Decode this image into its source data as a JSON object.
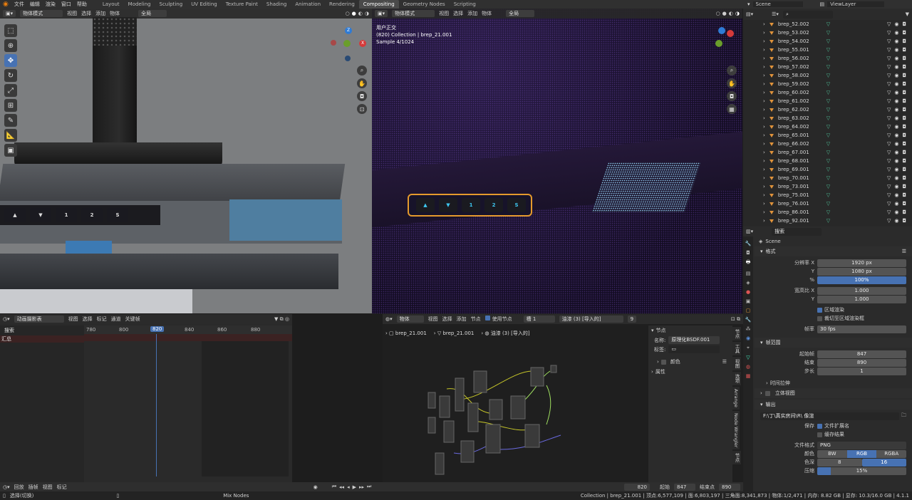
{
  "menu": [
    "文件",
    "编辑",
    "渲染",
    "窗口",
    "帮助"
  ],
  "workspaces": [
    "Layout",
    "Modeling",
    "Sculpting",
    "UV Editing",
    "Texture Paint",
    "Shading",
    "Animation",
    "Rendering",
    "Compositing",
    "Geometry Nodes",
    "Scripting"
  ],
  "scene": "Scene",
  "view_layer": "ViewLayer",
  "viewport_left": {
    "mode": "物体模式",
    "menus": [
      "视图",
      "选择",
      "添加",
      "物体"
    ],
    "transform": "全局",
    "keys": [
      "1",
      "2",
      "S"
    ]
  },
  "viewport_right": {
    "mode": "物体模式",
    "menus": [
      "视图",
      "选择",
      "添加",
      "物体"
    ],
    "transform": "全局",
    "overlay_line1": "用户正交",
    "overlay_line2": "(820) Collection | brep_21.001",
    "overlay_line3": "Sample 4/1024",
    "keys": [
      "1",
      "2",
      "S"
    ]
  },
  "outliner": {
    "search_placeholder": "",
    "items": [
      "brep_52.002",
      "brep_53.002",
      "brep_54.002",
      "brep_55.001",
      "brep_56.002",
      "brep_57.002",
      "brep_58.002",
      "brep_59.002",
      "brep_60.002",
      "brep_61.002",
      "brep_62.002",
      "brep_63.002",
      "brep_64.002",
      "brep_65.001",
      "brep_66.002",
      "brep_67.001",
      "brep_68.001",
      "brep_69.001",
      "brep_70.001",
      "brep_73.001",
      "brep_75.001",
      "brep_76.001",
      "brep_86.001",
      "brep_92.001"
    ]
  },
  "properties": {
    "search_placeholder": "搜索",
    "scene_name": "Scene",
    "format_title": "格式",
    "res_x_label": "分辨率 X",
    "res_x": "1920 px",
    "res_y_label": "Y",
    "res_y": "1080 px",
    "pct_label": "%",
    "pct": "100%",
    "aspect_x_label": "宽高比 X",
    "aspect_x": "1.000",
    "aspect_y_label": "Y",
    "aspect_y": "1.000",
    "border_label": "区域渲染",
    "crop_label": "裁切至区域渲染框",
    "fps_label": "帧率",
    "fps": "30 fps",
    "frame_range_title": "帧范围",
    "start_label": "起始帧",
    "start": "847",
    "end_label": "结束",
    "end": "890",
    "step_label": "步长",
    "step": "1",
    "time_stretch": "时间拉伸",
    "stereo": "立体视图",
    "output_title": "输出",
    "output_path": "F:\\丁\\真实房间\\R\\ 像渲",
    "save_label": "保存",
    "file_ext_label": "文件扩展名",
    "cache_label": "缓存结果",
    "file_format_label": "文件格式",
    "file_format": "PNG",
    "color_label": "颜色",
    "color_opts": [
      "BW",
      "RGB",
      "RGBA"
    ],
    "depth_label": "色深",
    "depth_opts": [
      "8",
      "16"
    ],
    "compression_label": "压缩",
    "compression": "15%"
  },
  "dopesheet": {
    "editor": "动画摄影表",
    "menus": [
      "视图",
      "选择",
      "标记",
      "通道",
      "关键帧"
    ],
    "search_placeholder": "搜索",
    "ticks": [
      "780",
      "800",
      "820",
      "840",
      "860",
      "880"
    ],
    "current": "820",
    "summary": "汇总"
  },
  "timeline": {
    "menus": [
      "回放",
      "插帧",
      "视图",
      "标记"
    ],
    "frame": "820",
    "start_label": "起始",
    "start": "847",
    "end_label": "结束点",
    "end": "890"
  },
  "node_editor": {
    "type": "物体",
    "menus": [
      "视图",
      "选择",
      "添加",
      "节点"
    ],
    "use_nodes": "使用节点",
    "slot": "槽 1",
    "material": "油漆 (3) [导入的]",
    "users": "9",
    "breadcrumb": [
      "brep_21.001",
      "brep_21.001",
      "油漆 (3) [导入的]"
    ],
    "side_title": "节点",
    "name_label": "名称:",
    "name_value": "原理化BSDF.001",
    "label_label": "标签:",
    "color_section": "颜色",
    "props_section": "属性",
    "tabs": [
      "节点",
      "工具",
      "视图",
      "选项",
      "Arrange",
      "Node Wrangler",
      "节点"
    ]
  },
  "statusbar": {
    "select": "选择(切换)",
    "mix": "Mix Nodes",
    "stats": "Collection | brep_21.001 | 顶点:6,577,109 | 面:6,803,197 | 三角面:8,341,873 | 物体:1/2,471 | 内存: 8.82 GB | 显存: 10.3/16.0 GB | 4.1.1"
  }
}
